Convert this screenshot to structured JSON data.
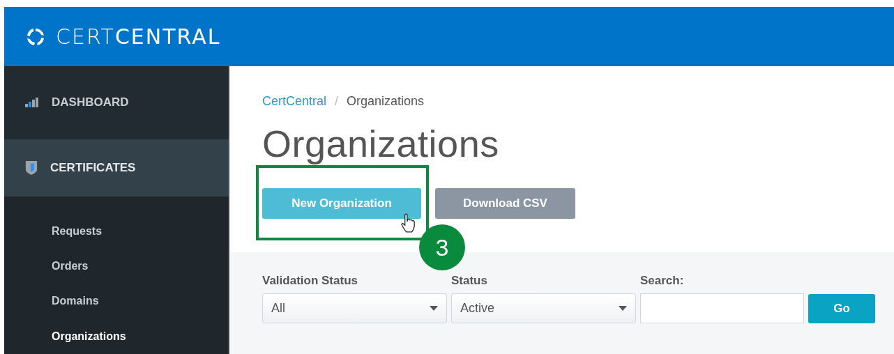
{
  "header": {
    "logo": "CERT**CENTRAL**"
  },
  "sidebar": {
    "items": [
      {
        "kind": "section",
        "label": "DASHBOARD",
        "selected": false
      },
      {
        "kind": "section",
        "label": "CERTIFICATES",
        "selected": true
      },
      {
        "kind": "subitem",
        "label": "Requests",
        "selected": false
      },
      {
        "kind": "subitem",
        "label": "Orders",
        "selected": false
      },
      {
        "kind": "subitem",
        "label": "Domains",
        "selected": false
      },
      {
        "kind": "subitem",
        "label": "Organizations",
        "selected": true
      }
    ]
  },
  "breadcrumb": [
    {
      "label": "CertCentral",
      "kind": "link"
    },
    {
      "label": "/",
      "kind": "separator"
    },
    {
      "label": "Organizations",
      "kind": "current"
    }
  ],
  "page_title": "Organizations",
  "buttons": [
    {
      "label": "New Organization",
      "kind": "primary"
    },
    {
      "label": "Download CSV",
      "kind": "secondary"
    }
  ],
  "annotation": {
    "step": "3"
  },
  "filters": {
    "validation_status": {
      "label": "Validation Status",
      "value": "All"
    },
    "status": {
      "label": "Status",
      "value": "Active"
    },
    "search": {
      "label": "Search:"
    },
    "go_button": "Go"
  }
}
